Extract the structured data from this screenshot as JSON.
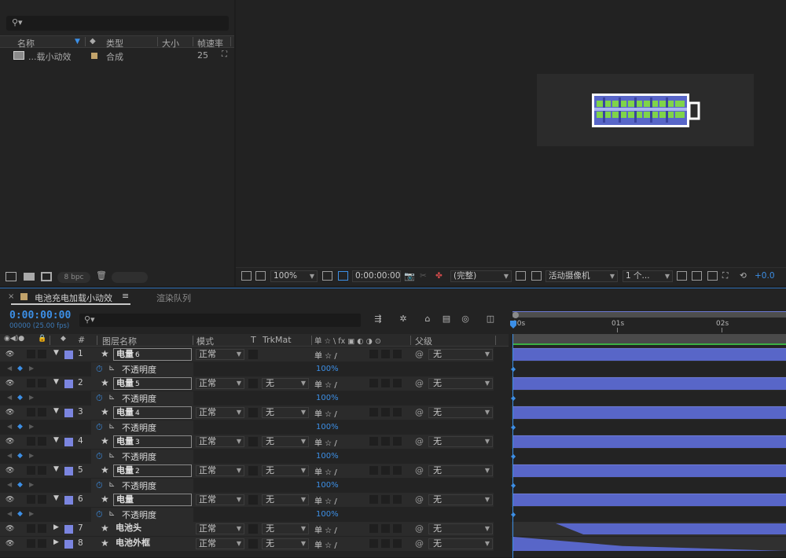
{
  "project": {
    "search_placeholder": "",
    "columns": {
      "name": "名称",
      "type": "类型",
      "size": "大小",
      "fps": "帧速率"
    },
    "item": {
      "name": "...载小动效",
      "type": "合成",
      "size": "",
      "fps": "25"
    },
    "bpc": "8 bpc"
  },
  "viewer_toolbar": {
    "zoom": "100%",
    "timecode": "0:00:00:00",
    "resolution": "(完整)",
    "camera": "活动摄像机",
    "views": "1 个...",
    "exposure": "+0.0"
  },
  "timeline": {
    "tab_comp": "电池充电加载小动效",
    "tab_menu": "≡",
    "tab_render": "渲染队列",
    "timecode": "0:00:00:00",
    "framecode": "00000 (25.00 fps)",
    "header": {
      "num": "#",
      "layer_name": "图层名称",
      "mode": "模式",
      "t": "T",
      "trkmat": "TrkMat",
      "switches": "单 ☆ \\ fx ▣ ◐ ◑ ⊙",
      "parent": "父级"
    },
    "ruler_labels": [
      "00s",
      "01s",
      "02s"
    ],
    "layers": [
      {
        "num": "1",
        "name": "电量",
        "sub": "6",
        "mode": "正常",
        "trkmat": "",
        "parent": "无",
        "prop": "不透明度",
        "value": "100%"
      },
      {
        "num": "2",
        "name": "电量",
        "sub": "5",
        "mode": "正常",
        "trkmat": "无",
        "parent": "无",
        "prop": "不透明度",
        "value": "100%"
      },
      {
        "num": "3",
        "name": "电量",
        "sub": "4",
        "mode": "正常",
        "trkmat": "无",
        "parent": "无",
        "prop": "不透明度",
        "value": "100%"
      },
      {
        "num": "4",
        "name": "电量",
        "sub": "3",
        "mode": "正常",
        "trkmat": "无",
        "parent": "无",
        "prop": "不透明度",
        "value": "100%"
      },
      {
        "num": "5",
        "name": "电量",
        "sub": "2",
        "mode": "正常",
        "trkmat": "无",
        "parent": "无",
        "prop": "不透明度",
        "value": "100%"
      },
      {
        "num": "6",
        "name": "电量",
        "sub": "",
        "mode": "正常",
        "trkmat": "无",
        "parent": "无",
        "prop": "不透明度",
        "value": "100%"
      },
      {
        "num": "7",
        "name": "电池头",
        "sub": "",
        "mode": "正常",
        "trkmat": "无",
        "parent": "无"
      },
      {
        "num": "8",
        "name": "电池外框",
        "sub": "",
        "mode": "正常",
        "trkmat": "无",
        "parent": "无"
      }
    ]
  },
  "colors": {
    "accent": "#3c8fe6",
    "layer_label": "#7b85e0",
    "bar": "#5866c8",
    "battery_fill": "#7fd44a"
  }
}
